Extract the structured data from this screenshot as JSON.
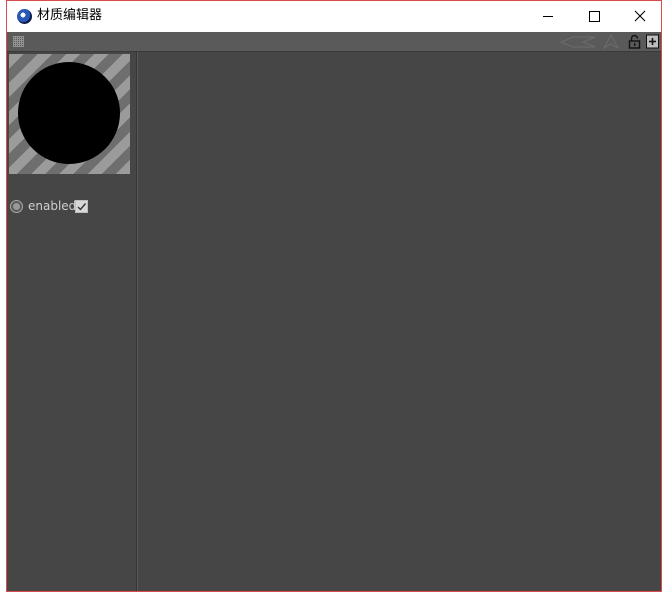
{
  "window": {
    "title": "材质编辑器",
    "icons": {
      "app": "cinema4d-logo-icon",
      "minimize": "minimize-icon",
      "maximize": "maximize-icon",
      "close": "close-icon"
    }
  },
  "toolbar": {
    "icons": [
      "grip-icon",
      "back-arrow-icon",
      "up-arrow-icon",
      "lock-icon",
      "new-panel-icon"
    ]
  },
  "left_panel": {
    "preview_icon": "material-preview-sphere",
    "enabled_label": "enabled",
    "enabled_checked": true
  },
  "colors": {
    "background": "#464646",
    "toolbar": "#5a5a5a",
    "window_border": "#d94c4c"
  }
}
